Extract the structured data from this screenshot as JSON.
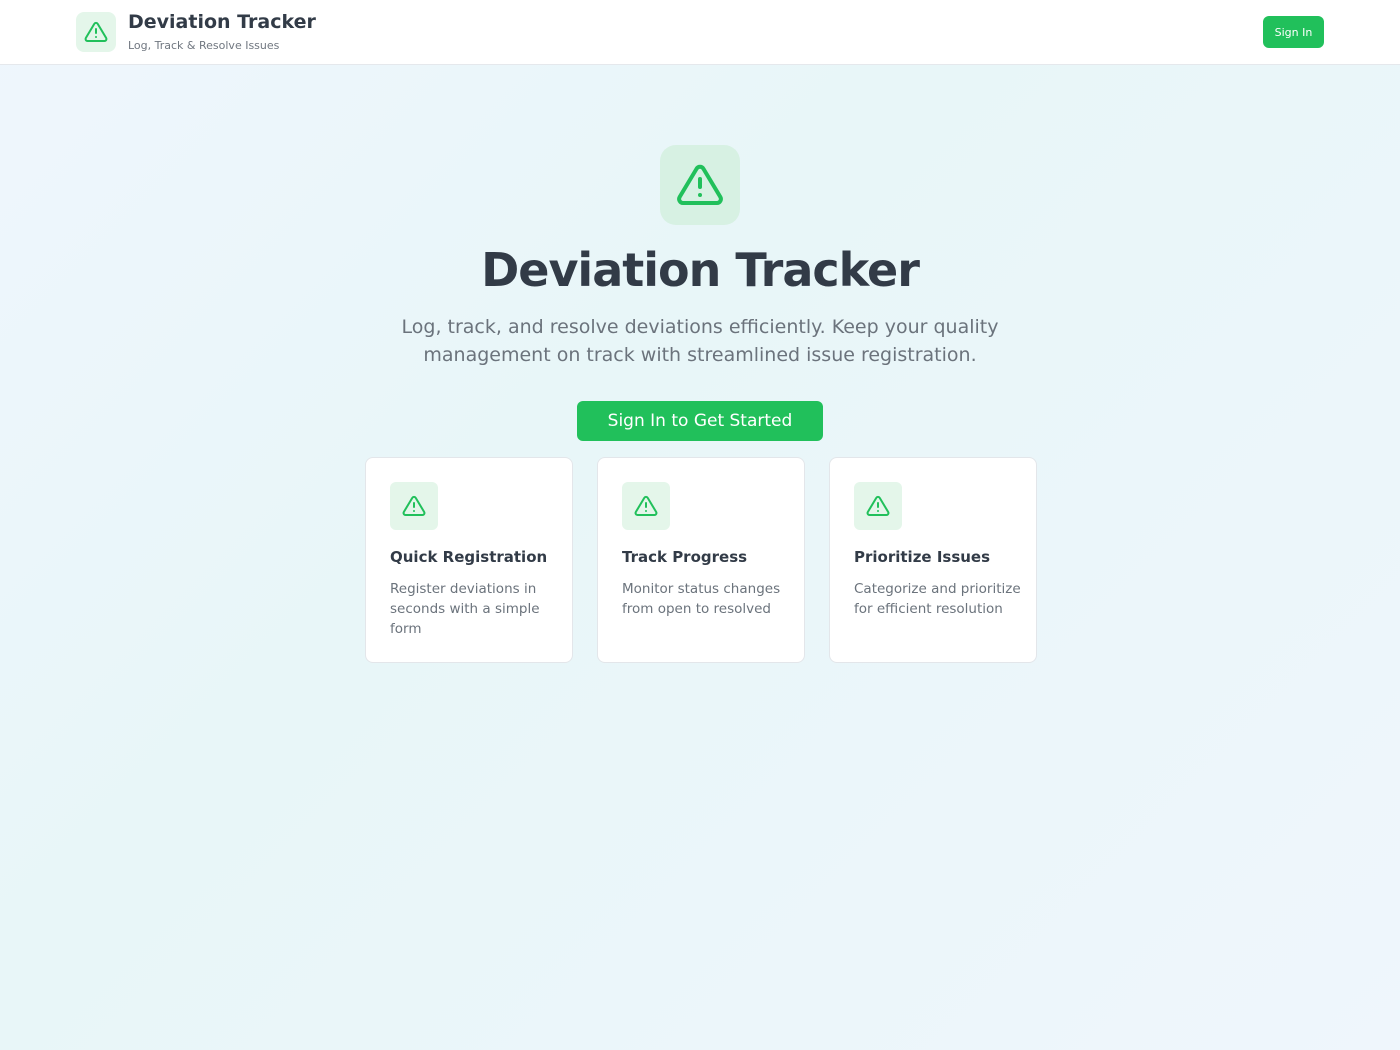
{
  "header": {
    "title": "Deviation Tracker",
    "subtitle": "Log, Track & Resolve Issues",
    "icon": "warning-triangle-icon",
    "sign_in_label": "Sign In"
  },
  "hero": {
    "icon": "warning-triangle-icon",
    "title": "Deviation Tracker",
    "description": "Log, track, and resolve deviations efficiently. Keep your quality management on track with streamlined issue registration.",
    "cta_label": "Sign In to Get Started"
  },
  "features": [
    {
      "icon": "warning-triangle-icon",
      "title": "Quick Registration",
      "description": "Register deviations in seconds with a simple form"
    },
    {
      "icon": "warning-triangle-icon",
      "title": "Track Progress",
      "description": "Monitor status changes from open to resolved"
    },
    {
      "icon": "warning-triangle-icon",
      "title": "Prioritize Issues",
      "description": "Categorize and prioritize for efficient resolution"
    }
  ],
  "colors": {
    "accent": "#21c05b",
    "icon_background": "#e4f6ea",
    "text_primary": "#323b47",
    "text_secondary": "#6b737c"
  }
}
